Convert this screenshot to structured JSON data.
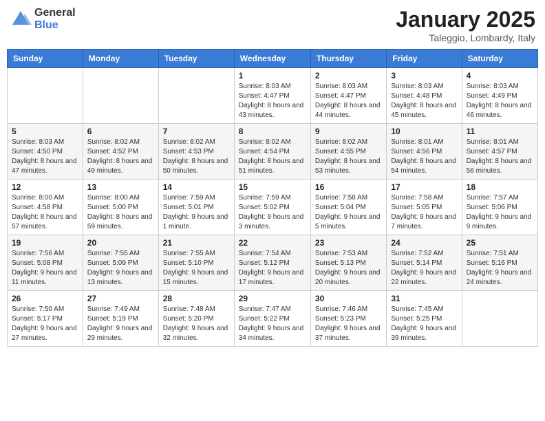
{
  "header": {
    "logo_general": "General",
    "logo_blue": "Blue",
    "month_title": "January 2025",
    "location": "Taleggio, Lombardy, Italy"
  },
  "weekdays": [
    "Sunday",
    "Monday",
    "Tuesday",
    "Wednesday",
    "Thursday",
    "Friday",
    "Saturday"
  ],
  "weeks": [
    [
      {
        "day": "",
        "sunrise": "",
        "sunset": "",
        "daylight": ""
      },
      {
        "day": "",
        "sunrise": "",
        "sunset": "",
        "daylight": ""
      },
      {
        "day": "",
        "sunrise": "",
        "sunset": "",
        "daylight": ""
      },
      {
        "day": "1",
        "sunrise": "Sunrise: 8:03 AM",
        "sunset": "Sunset: 4:47 PM",
        "daylight": "Daylight: 8 hours and 43 minutes."
      },
      {
        "day": "2",
        "sunrise": "Sunrise: 8:03 AM",
        "sunset": "Sunset: 4:47 PM",
        "daylight": "Daylight: 8 hours and 44 minutes."
      },
      {
        "day": "3",
        "sunrise": "Sunrise: 8:03 AM",
        "sunset": "Sunset: 4:48 PM",
        "daylight": "Daylight: 8 hours and 45 minutes."
      },
      {
        "day": "4",
        "sunrise": "Sunrise: 8:03 AM",
        "sunset": "Sunset: 4:49 PM",
        "daylight": "Daylight: 8 hours and 46 minutes."
      }
    ],
    [
      {
        "day": "5",
        "sunrise": "Sunrise: 8:03 AM",
        "sunset": "Sunset: 4:50 PM",
        "daylight": "Daylight: 8 hours and 47 minutes."
      },
      {
        "day": "6",
        "sunrise": "Sunrise: 8:02 AM",
        "sunset": "Sunset: 4:52 PM",
        "daylight": "Daylight: 8 hours and 49 minutes."
      },
      {
        "day": "7",
        "sunrise": "Sunrise: 8:02 AM",
        "sunset": "Sunset: 4:53 PM",
        "daylight": "Daylight: 8 hours and 50 minutes."
      },
      {
        "day": "8",
        "sunrise": "Sunrise: 8:02 AM",
        "sunset": "Sunset: 4:54 PM",
        "daylight": "Daylight: 8 hours and 51 minutes."
      },
      {
        "day": "9",
        "sunrise": "Sunrise: 8:02 AM",
        "sunset": "Sunset: 4:55 PM",
        "daylight": "Daylight: 8 hours and 53 minutes."
      },
      {
        "day": "10",
        "sunrise": "Sunrise: 8:01 AM",
        "sunset": "Sunset: 4:56 PM",
        "daylight": "Daylight: 8 hours and 54 minutes."
      },
      {
        "day": "11",
        "sunrise": "Sunrise: 8:01 AM",
        "sunset": "Sunset: 4:57 PM",
        "daylight": "Daylight: 8 hours and 56 minutes."
      }
    ],
    [
      {
        "day": "12",
        "sunrise": "Sunrise: 8:00 AM",
        "sunset": "Sunset: 4:58 PM",
        "daylight": "Daylight: 8 hours and 57 minutes."
      },
      {
        "day": "13",
        "sunrise": "Sunrise: 8:00 AM",
        "sunset": "Sunset: 5:00 PM",
        "daylight": "Daylight: 8 hours and 59 minutes."
      },
      {
        "day": "14",
        "sunrise": "Sunrise: 7:59 AM",
        "sunset": "Sunset: 5:01 PM",
        "daylight": "Daylight: 9 hours and 1 minute."
      },
      {
        "day": "15",
        "sunrise": "Sunrise: 7:59 AM",
        "sunset": "Sunset: 5:02 PM",
        "daylight": "Daylight: 9 hours and 3 minutes."
      },
      {
        "day": "16",
        "sunrise": "Sunrise: 7:58 AM",
        "sunset": "Sunset: 5:04 PM",
        "daylight": "Daylight: 9 hours and 5 minutes."
      },
      {
        "day": "17",
        "sunrise": "Sunrise: 7:58 AM",
        "sunset": "Sunset: 5:05 PM",
        "daylight": "Daylight: 9 hours and 7 minutes."
      },
      {
        "day": "18",
        "sunrise": "Sunrise: 7:57 AM",
        "sunset": "Sunset: 5:06 PM",
        "daylight": "Daylight: 9 hours and 9 minutes."
      }
    ],
    [
      {
        "day": "19",
        "sunrise": "Sunrise: 7:56 AM",
        "sunset": "Sunset: 5:08 PM",
        "daylight": "Daylight: 9 hours and 11 minutes."
      },
      {
        "day": "20",
        "sunrise": "Sunrise: 7:55 AM",
        "sunset": "Sunset: 5:09 PM",
        "daylight": "Daylight: 9 hours and 13 minutes."
      },
      {
        "day": "21",
        "sunrise": "Sunrise: 7:55 AM",
        "sunset": "Sunset: 5:10 PM",
        "daylight": "Daylight: 9 hours and 15 minutes."
      },
      {
        "day": "22",
        "sunrise": "Sunrise: 7:54 AM",
        "sunset": "Sunset: 5:12 PM",
        "daylight": "Daylight: 9 hours and 17 minutes."
      },
      {
        "day": "23",
        "sunrise": "Sunrise: 7:53 AM",
        "sunset": "Sunset: 5:13 PM",
        "daylight": "Daylight: 9 hours and 20 minutes."
      },
      {
        "day": "24",
        "sunrise": "Sunrise: 7:52 AM",
        "sunset": "Sunset: 5:14 PM",
        "daylight": "Daylight: 9 hours and 22 minutes."
      },
      {
        "day": "25",
        "sunrise": "Sunrise: 7:51 AM",
        "sunset": "Sunset: 5:16 PM",
        "daylight": "Daylight: 9 hours and 24 minutes."
      }
    ],
    [
      {
        "day": "26",
        "sunrise": "Sunrise: 7:50 AM",
        "sunset": "Sunset: 5:17 PM",
        "daylight": "Daylight: 9 hours and 27 minutes."
      },
      {
        "day": "27",
        "sunrise": "Sunrise: 7:49 AM",
        "sunset": "Sunset: 5:19 PM",
        "daylight": "Daylight: 9 hours and 29 minutes."
      },
      {
        "day": "28",
        "sunrise": "Sunrise: 7:48 AM",
        "sunset": "Sunset: 5:20 PM",
        "daylight": "Daylight: 9 hours and 32 minutes."
      },
      {
        "day": "29",
        "sunrise": "Sunrise: 7:47 AM",
        "sunset": "Sunset: 5:22 PM",
        "daylight": "Daylight: 9 hours and 34 minutes."
      },
      {
        "day": "30",
        "sunrise": "Sunrise: 7:46 AM",
        "sunset": "Sunset: 5:23 PM",
        "daylight": "Daylight: 9 hours and 37 minutes."
      },
      {
        "day": "31",
        "sunrise": "Sunrise: 7:45 AM",
        "sunset": "Sunset: 5:25 PM",
        "daylight": "Daylight: 9 hours and 39 minutes."
      },
      {
        "day": "",
        "sunrise": "",
        "sunset": "",
        "daylight": ""
      }
    ]
  ]
}
